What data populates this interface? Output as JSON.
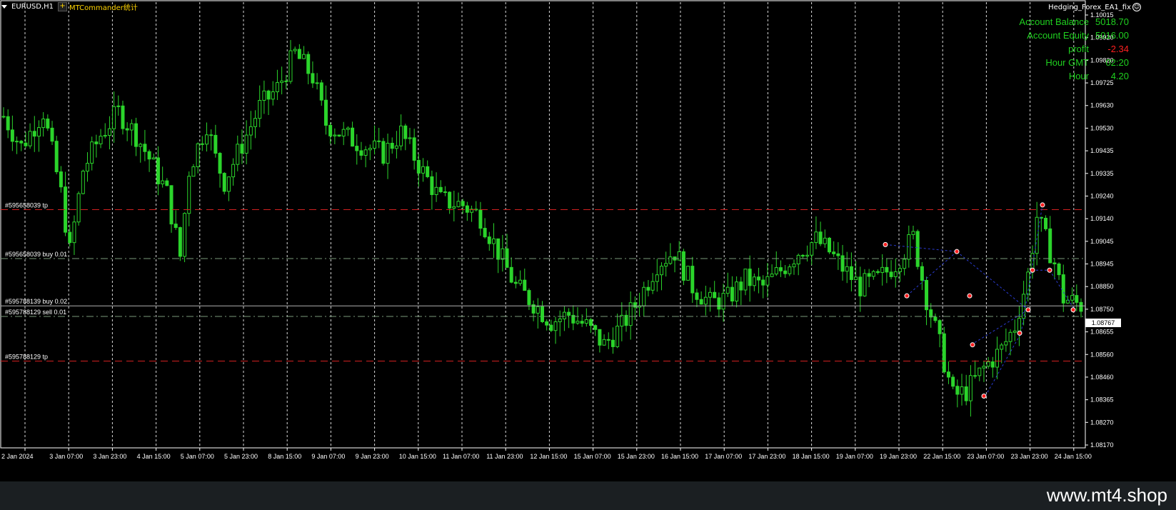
{
  "header": {
    "symbol": "EURUSD,H1",
    "indicator_label": "MTCommander统计",
    "ea_name": "Hedging_Forex_EA1_fix"
  },
  "info_panel": {
    "rows": [
      {
        "label": "Account Balance",
        "value": "5018.70",
        "negative": false
      },
      {
        "label": "Account Equity",
        "value": "5016.00",
        "negative": false
      },
      {
        "label": "profit",
        "value": "-2.34",
        "negative": true
      },
      {
        "label": "Hour GMT",
        "value": "02:20",
        "negative": false
      },
      {
        "label": "Hour",
        "value": "4.20",
        "negative": false
      }
    ]
  },
  "current_price": "1.08767",
  "order_lines": [
    {
      "label": "#595658039 tp",
      "price": 1.0918,
      "style": "dash",
      "color": "#d12020"
    },
    {
      "label": "#595658039 buy 0.01",
      "price": 1.0897,
      "style": "dashdot",
      "color": "#7a9a7a"
    },
    {
      "label": "#595788139 buy 0.02",
      "price": 1.08767,
      "style": "solid",
      "color": "#b0b0b0"
    },
    {
      "label": "#595788129 sell 0.01",
      "price": 1.0874,
      "style": "dashdot",
      "color": "#7a9a7a"
    },
    {
      "label": "#595788129 tp",
      "price": 1.0853,
      "style": "dash",
      "color": "#d12020"
    }
  ],
  "watermark": "www.mt4.shop",
  "colors": {
    "background": "#000000",
    "bull_candle": "#2bd42b",
    "grid": "#ffffff",
    "axis": "#ffffff",
    "panel_text": "#1fd11f",
    "loss_text": "#ff2020",
    "tp_line": "#d12020",
    "order_line": "#7a9a7a"
  },
  "chart_data": {
    "type": "candlestick",
    "symbol": "EURUSD",
    "timeframe": "H1",
    "y_axis": {
      "ticks": [
        "1.10015",
        "1.09920",
        "1.09820",
        "1.09725",
        "1.09630",
        "1.09530",
        "1.09435",
        "1.09335",
        "1.09240",
        "1.09140",
        "1.09045",
        "1.08945",
        "1.08850",
        "1.08750",
        "1.08655",
        "1.08560",
        "1.08460",
        "1.08365",
        "1.08270",
        "1.08170"
      ],
      "ylim": [
        1.0817,
        1.10015
      ]
    },
    "x_axis": {
      "ticks": [
        "2 Jan 2024",
        "3 Jan 07:00",
        "3 Jan 23:00",
        "4 Jan 15:00",
        "5 Jan 07:00",
        "5 Jan 23:00",
        "8 Jan 15:00",
        "9 Jan 07:00",
        "9 Jan 23:00",
        "10 Jan 15:00",
        "11 Jan 07:00",
        "11 Jan 23:00",
        "12 Jan 15:00",
        "15 Jan 07:00",
        "15 Jan 23:00",
        "16 Jan 15:00",
        "17 Jan 07:00",
        "17 Jan 23:00",
        "18 Jan 15:00",
        "19 Jan 07:00",
        "19 Jan 23:00",
        "22 Jan 15:00",
        "23 Jan 07:00",
        "23 Jan 23:00",
        "24 Jan 15:00"
      ]
    },
    "grid": true,
    "series": [
      {
        "name": "EURUSD,H1",
        "anchors": [
          [
            0,
            1.0958
          ],
          [
            4,
            1.0945
          ],
          [
            9,
            1.096
          ],
          [
            13,
            1.0925
          ],
          [
            15,
            1.09
          ],
          [
            18,
            1.0935
          ],
          [
            22,
            1.095
          ],
          [
            26,
            1.096
          ],
          [
            30,
            1.095
          ],
          [
            33,
            1.094
          ],
          [
            37,
            1.0925
          ],
          [
            40,
            1.0898
          ],
          [
            42,
            1.0935
          ],
          [
            46,
            1.0955
          ],
          [
            48,
            1.094
          ],
          [
            50,
            1.093
          ],
          [
            55,
            1.095
          ],
          [
            58,
            1.0962
          ],
          [
            62,
            1.097
          ],
          [
            66,
            1.0985
          ],
          [
            70,
            1.0975
          ],
          [
            73,
            1.0955
          ],
          [
            77,
            1.095
          ],
          [
            81,
            1.0946
          ],
          [
            86,
            1.0942
          ],
          [
            90,
            1.0951
          ],
          [
            95,
            1.0934
          ],
          [
            99,
            1.0922
          ],
          [
            104,
            1.092
          ],
          [
            108,
            1.0915
          ],
          [
            112,
            1.09
          ],
          [
            116,
            1.0885
          ],
          [
            120,
            1.0878
          ],
          [
            124,
            1.087
          ],
          [
            128,
            1.0873
          ],
          [
            132,
            1.0868
          ],
          [
            136,
            1.086
          ],
          [
            140,
            1.0868
          ],
          [
            144,
            1.088
          ],
          [
            148,
            1.0895
          ],
          [
            152,
            1.09
          ],
          [
            156,
            1.0885
          ],
          [
            160,
            1.0878
          ],
          [
            164,
            1.088
          ],
          [
            168,
            1.0888
          ],
          [
            172,
            1.0885
          ],
          [
            176,
            1.0892
          ],
          [
            180,
            1.09
          ],
          [
            184,
            1.0905
          ],
          [
            187,
            1.09
          ],
          [
            190,
            1.0893
          ],
          [
            194,
            1.0885
          ],
          [
            198,
            1.0888
          ],
          [
            202,
            1.0895
          ],
          [
            206,
            1.0906
          ],
          [
            209,
            1.088
          ],
          [
            212,
            1.086
          ],
          [
            215,
            1.0838
          ],
          [
            218,
            1.084
          ],
          [
            222,
            1.085
          ],
          [
            226,
            1.0858
          ],
          [
            229,
            1.0868
          ],
          [
            232,
            1.089
          ],
          [
            234,
            1.0915
          ],
          [
            236,
            1.0905
          ],
          [
            238,
            1.0895
          ],
          [
            240,
            1.088
          ],
          [
            244,
            1.0877
          ]
        ]
      }
    ],
    "total_bars": 245
  }
}
